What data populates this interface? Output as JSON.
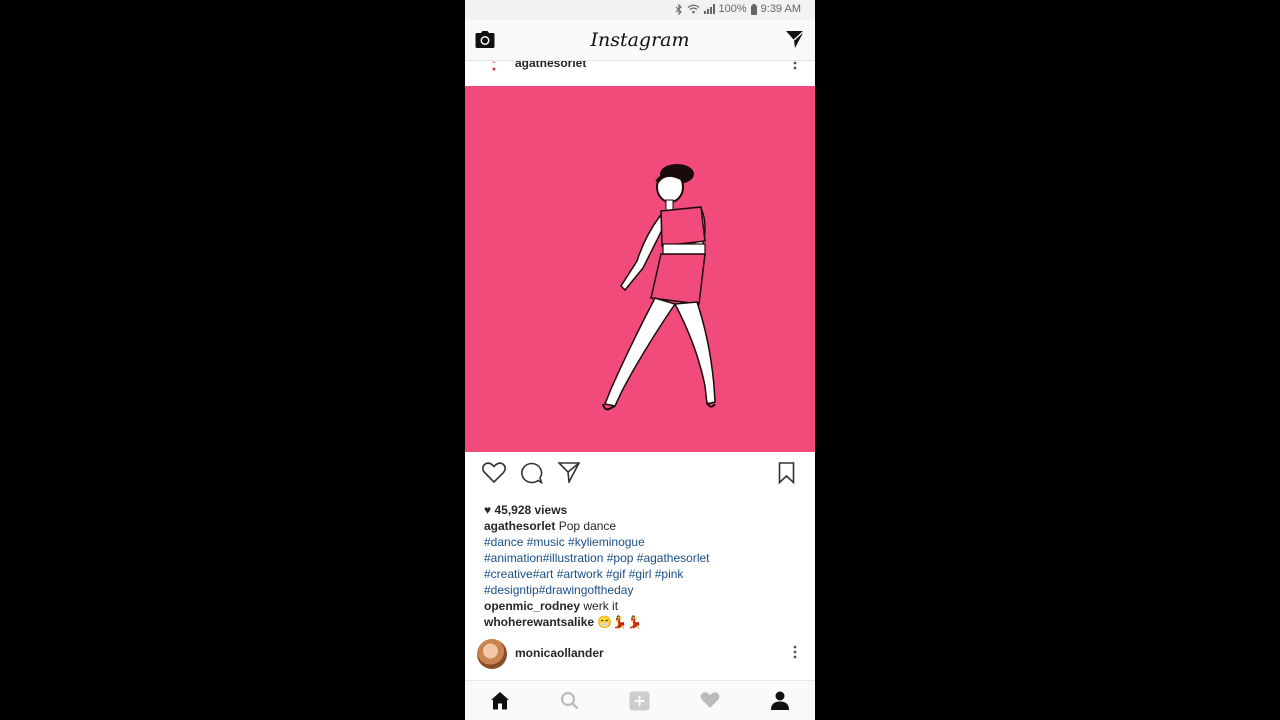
{
  "status_bar": {
    "battery": "100%",
    "time": "9:39 AM"
  },
  "top_nav": {
    "camera_icon": "camera-icon",
    "app_title": "Instagram",
    "direct_icon": "direct-message-icon"
  },
  "post": {
    "username": "agathesorlet",
    "image_colors": {
      "background": "#f04b7b",
      "skirt": "#f04b7b"
    },
    "views_text": "45,928 views",
    "caption_user": "agathesorlet",
    "caption_text": "Pop dance",
    "hashtag_lines": [
      "#dance #music #kylieminogue",
      "#animation#illustration #pop #agathesorlet",
      "#creative#art #artwork #gif #girl #pink",
      "#designtip#drawingoftheday"
    ],
    "comments": [
      {
        "user": "openmic_rodney",
        "text": "werk it"
      },
      {
        "user": "whoherewantsalike",
        "text": "😁💃💃"
      }
    ]
  },
  "next_post": {
    "username": "monicaollander"
  },
  "colors": {
    "hashtag": "#1a4f86",
    "post_bg": "#f04b7b"
  }
}
